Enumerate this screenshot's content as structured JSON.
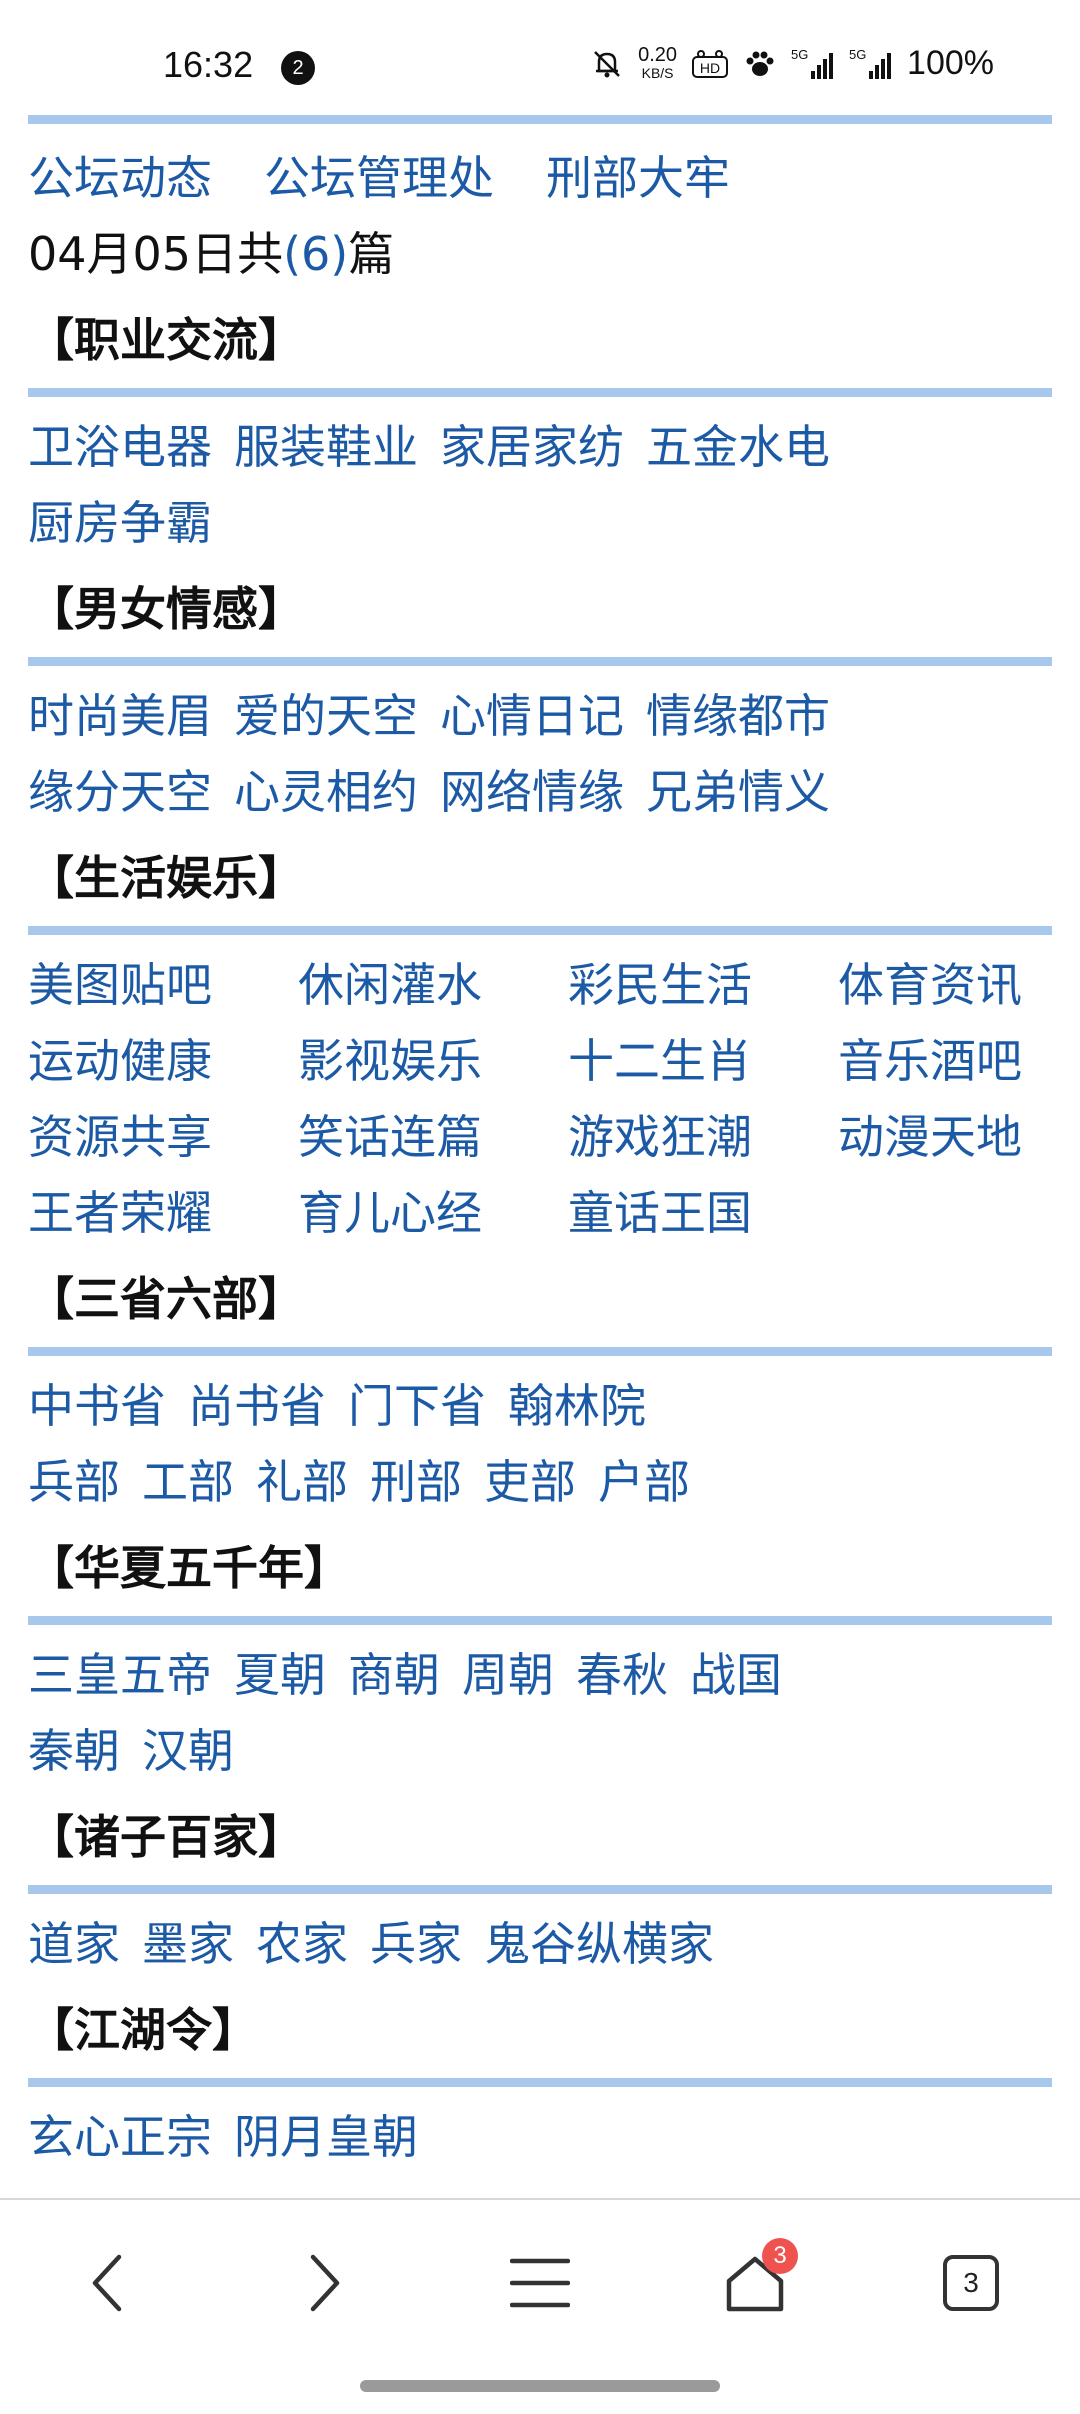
{
  "status_bar": {
    "time": "16:32",
    "notification_count": "2",
    "net_speed_value": "0.20",
    "net_speed_unit": "KB/S",
    "hd_label": "HD",
    "signal1_label": "5G",
    "signal2_label": "5G",
    "battery": "100%"
  },
  "top_links": [
    "公坛动态",
    "公坛管理处",
    "刑部大牢"
  ],
  "date_line": {
    "prefix": "04月05日共",
    "count": "(6)",
    "suffix": "篇"
  },
  "sections": [
    {
      "title": "【职业交流】",
      "rows": [
        [
          "卫浴电器",
          "服装鞋业",
          "家居家纺",
          "五金水电"
        ],
        [
          "厨房争霸"
        ]
      ]
    },
    {
      "title": "【男女情感】",
      "rows": [
        [
          "时尚美眉",
          "爱的天空",
          "心情日记",
          "情缘都市"
        ],
        [
          "缘分天空",
          "心灵相约",
          "网络情缘",
          "兄弟情义"
        ]
      ]
    },
    {
      "title": "【生活娱乐】",
      "grid": [
        "美图贴吧",
        "休闲灌水",
        "彩民生活",
        "体育资讯",
        "运动健康",
        "影视娱乐",
        "十二生肖",
        "音乐酒吧",
        "资源共享",
        "笑话连篇",
        "游戏狂潮",
        "动漫天地",
        "王者荣耀",
        "育儿心经",
        "童话王国"
      ]
    },
    {
      "title": "【三省六部】",
      "rows": [
        [
          "中书省",
          "尚书省",
          "门下省",
          "翰林院"
        ],
        [
          "兵部",
          "工部",
          "礼部",
          "刑部",
          "吏部",
          "户部"
        ]
      ]
    },
    {
      "title": "【华夏五千年】",
      "rows": [
        [
          "三皇五帝",
          "夏朝",
          "商朝",
          "周朝",
          "春秋",
          "战国"
        ],
        [
          "秦朝",
          "汉朝"
        ]
      ]
    },
    {
      "title": "【诸子百家】",
      "rows": [
        [
          "道家",
          "墨家",
          "农家",
          "兵家",
          "鬼谷纵横家"
        ]
      ]
    },
    {
      "title": "【江湖令】",
      "rows": [
        [
          "玄心正宗",
          "阴月皇朝"
        ]
      ]
    }
  ],
  "bottom_nav": {
    "back_icon": "chevron-left-icon",
    "forward_icon": "chevron-right-icon",
    "menu_icon": "hamburger-menu-icon",
    "home_icon": "home-icon",
    "home_badge": "3",
    "tabs_count": "3"
  },
  "colors": {
    "link": "#1c5aa6",
    "rule": "#a8c8eb",
    "badge": "#ef5350"
  }
}
